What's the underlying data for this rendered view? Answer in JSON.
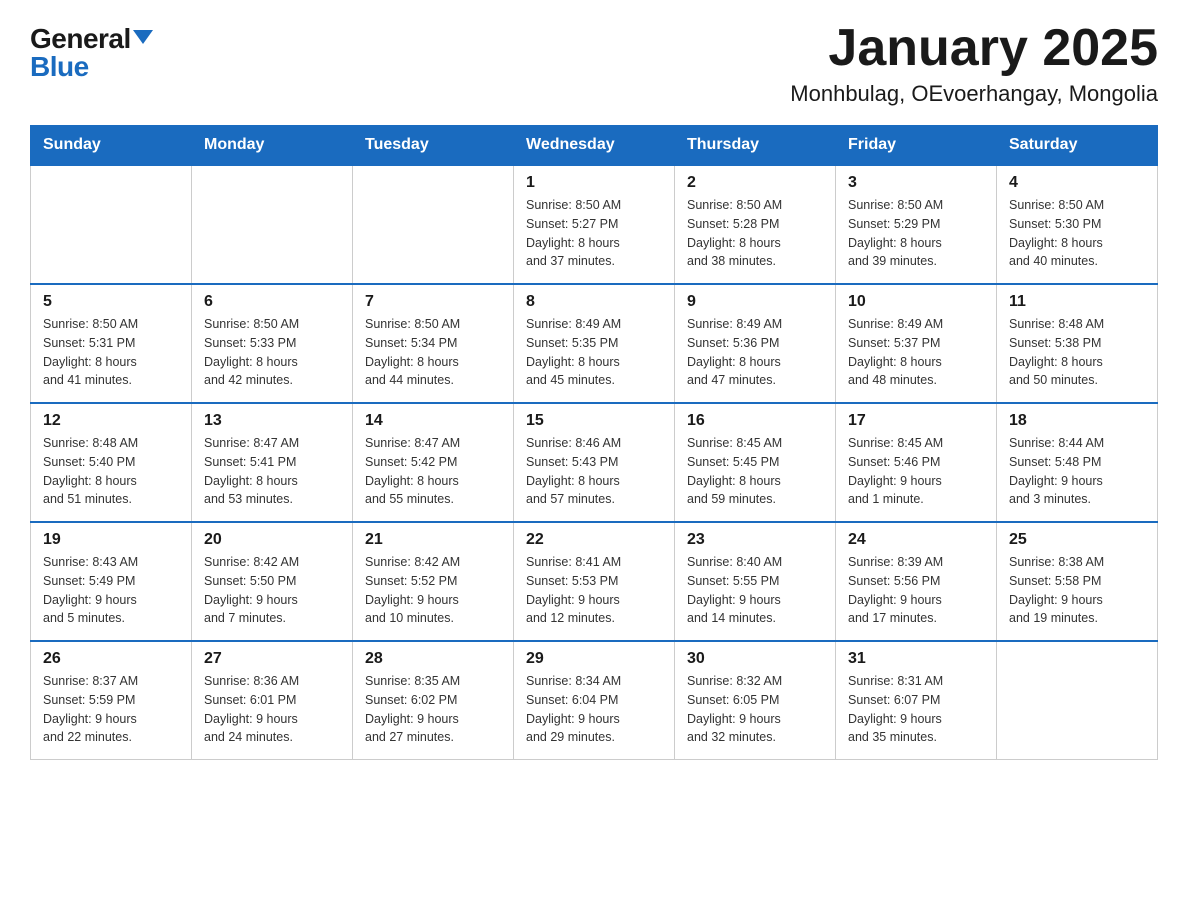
{
  "logo": {
    "general": "General",
    "blue": "Blue"
  },
  "title": "January 2025",
  "subtitle": "Monhbulag, OEvoerhangay, Mongolia",
  "calendar": {
    "headers": [
      "Sunday",
      "Monday",
      "Tuesday",
      "Wednesday",
      "Thursday",
      "Friday",
      "Saturday"
    ],
    "rows": [
      [
        {
          "day": "",
          "info": ""
        },
        {
          "day": "",
          "info": ""
        },
        {
          "day": "",
          "info": ""
        },
        {
          "day": "1",
          "info": "Sunrise: 8:50 AM\nSunset: 5:27 PM\nDaylight: 8 hours\nand 37 minutes."
        },
        {
          "day": "2",
          "info": "Sunrise: 8:50 AM\nSunset: 5:28 PM\nDaylight: 8 hours\nand 38 minutes."
        },
        {
          "day": "3",
          "info": "Sunrise: 8:50 AM\nSunset: 5:29 PM\nDaylight: 8 hours\nand 39 minutes."
        },
        {
          "day": "4",
          "info": "Sunrise: 8:50 AM\nSunset: 5:30 PM\nDaylight: 8 hours\nand 40 minutes."
        }
      ],
      [
        {
          "day": "5",
          "info": "Sunrise: 8:50 AM\nSunset: 5:31 PM\nDaylight: 8 hours\nand 41 minutes."
        },
        {
          "day": "6",
          "info": "Sunrise: 8:50 AM\nSunset: 5:33 PM\nDaylight: 8 hours\nand 42 minutes."
        },
        {
          "day": "7",
          "info": "Sunrise: 8:50 AM\nSunset: 5:34 PM\nDaylight: 8 hours\nand 44 minutes."
        },
        {
          "day": "8",
          "info": "Sunrise: 8:49 AM\nSunset: 5:35 PM\nDaylight: 8 hours\nand 45 minutes."
        },
        {
          "day": "9",
          "info": "Sunrise: 8:49 AM\nSunset: 5:36 PM\nDaylight: 8 hours\nand 47 minutes."
        },
        {
          "day": "10",
          "info": "Sunrise: 8:49 AM\nSunset: 5:37 PM\nDaylight: 8 hours\nand 48 minutes."
        },
        {
          "day": "11",
          "info": "Sunrise: 8:48 AM\nSunset: 5:38 PM\nDaylight: 8 hours\nand 50 minutes."
        }
      ],
      [
        {
          "day": "12",
          "info": "Sunrise: 8:48 AM\nSunset: 5:40 PM\nDaylight: 8 hours\nand 51 minutes."
        },
        {
          "day": "13",
          "info": "Sunrise: 8:47 AM\nSunset: 5:41 PM\nDaylight: 8 hours\nand 53 minutes."
        },
        {
          "day": "14",
          "info": "Sunrise: 8:47 AM\nSunset: 5:42 PM\nDaylight: 8 hours\nand 55 minutes."
        },
        {
          "day": "15",
          "info": "Sunrise: 8:46 AM\nSunset: 5:43 PM\nDaylight: 8 hours\nand 57 minutes."
        },
        {
          "day": "16",
          "info": "Sunrise: 8:45 AM\nSunset: 5:45 PM\nDaylight: 8 hours\nand 59 minutes."
        },
        {
          "day": "17",
          "info": "Sunrise: 8:45 AM\nSunset: 5:46 PM\nDaylight: 9 hours\nand 1 minute."
        },
        {
          "day": "18",
          "info": "Sunrise: 8:44 AM\nSunset: 5:48 PM\nDaylight: 9 hours\nand 3 minutes."
        }
      ],
      [
        {
          "day": "19",
          "info": "Sunrise: 8:43 AM\nSunset: 5:49 PM\nDaylight: 9 hours\nand 5 minutes."
        },
        {
          "day": "20",
          "info": "Sunrise: 8:42 AM\nSunset: 5:50 PM\nDaylight: 9 hours\nand 7 minutes."
        },
        {
          "day": "21",
          "info": "Sunrise: 8:42 AM\nSunset: 5:52 PM\nDaylight: 9 hours\nand 10 minutes."
        },
        {
          "day": "22",
          "info": "Sunrise: 8:41 AM\nSunset: 5:53 PM\nDaylight: 9 hours\nand 12 minutes."
        },
        {
          "day": "23",
          "info": "Sunrise: 8:40 AM\nSunset: 5:55 PM\nDaylight: 9 hours\nand 14 minutes."
        },
        {
          "day": "24",
          "info": "Sunrise: 8:39 AM\nSunset: 5:56 PM\nDaylight: 9 hours\nand 17 minutes."
        },
        {
          "day": "25",
          "info": "Sunrise: 8:38 AM\nSunset: 5:58 PM\nDaylight: 9 hours\nand 19 minutes."
        }
      ],
      [
        {
          "day": "26",
          "info": "Sunrise: 8:37 AM\nSunset: 5:59 PM\nDaylight: 9 hours\nand 22 minutes."
        },
        {
          "day": "27",
          "info": "Sunrise: 8:36 AM\nSunset: 6:01 PM\nDaylight: 9 hours\nand 24 minutes."
        },
        {
          "day": "28",
          "info": "Sunrise: 8:35 AM\nSunset: 6:02 PM\nDaylight: 9 hours\nand 27 minutes."
        },
        {
          "day": "29",
          "info": "Sunrise: 8:34 AM\nSunset: 6:04 PM\nDaylight: 9 hours\nand 29 minutes."
        },
        {
          "day": "30",
          "info": "Sunrise: 8:32 AM\nSunset: 6:05 PM\nDaylight: 9 hours\nand 32 minutes."
        },
        {
          "day": "31",
          "info": "Sunrise: 8:31 AM\nSunset: 6:07 PM\nDaylight: 9 hours\nand 35 minutes."
        },
        {
          "day": "",
          "info": ""
        }
      ]
    ]
  }
}
